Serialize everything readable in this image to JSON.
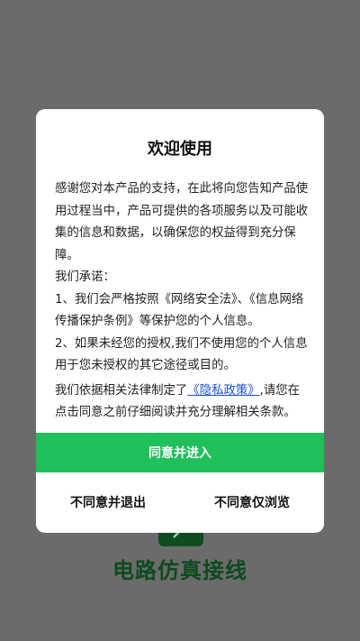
{
  "app": {
    "name": "电路仿真接线"
  },
  "dialog": {
    "title": "欢迎使用",
    "intro": "感谢您对本产品的支持，在此将向您告知产品使用过程当中，产品可提供的各项服务以及可能收集的信息和数据，以确保您的权益得到充分保障。",
    "promise_heading": "我们承诺：",
    "promise_1": "1、我们会严格按照《网络安全法》、《信息网络传播保护条例》等保护您的个人信息。",
    "promise_2": "2、如果未经您的授权,我们不使用您的个人信息用于您未授权的其它途径或目的。",
    "policy_prefix": "我们依据相关法律制定了",
    "policy_link": "《隐私政策》",
    "policy_suffix": ",请您在点击同意之前仔细阅读并充分理解相关条款。",
    "agree_label": "同意并进入",
    "disagree_exit_label": "不同意并退出",
    "disagree_browse_label": "不同意仅浏览"
  },
  "colors": {
    "overlay": "#6b6b6b",
    "agree_button": "#1fbf5a",
    "link": "#1a4fd6",
    "app_name": "#0e4a1e"
  }
}
